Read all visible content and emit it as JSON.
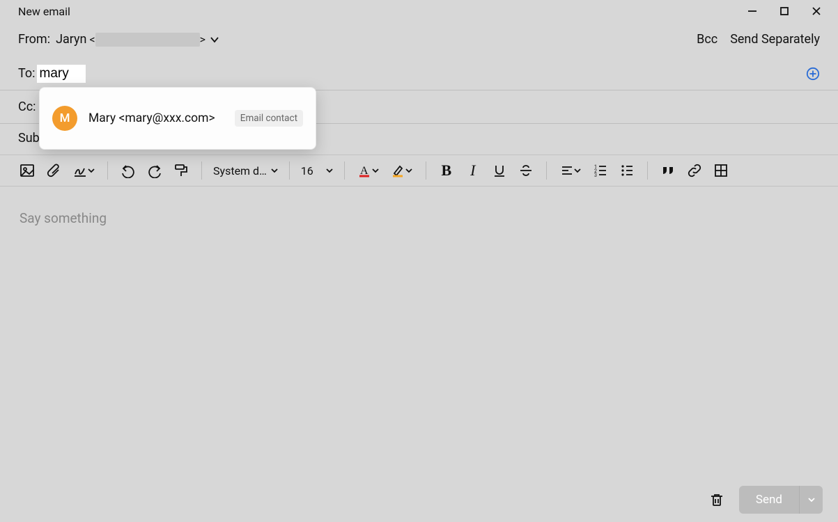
{
  "window": {
    "title": "New email"
  },
  "from": {
    "label": "From:",
    "name": "Jaryn",
    "prefix": "<",
    "suffix": ">"
  },
  "header_actions": {
    "bcc": "Bcc",
    "send_separately": "Send Separately"
  },
  "to": {
    "label": "To:",
    "value": "mary"
  },
  "cc": {
    "label": "Cc:"
  },
  "subject": {
    "label": "Subject:"
  },
  "autocomplete": {
    "avatar_initial": "M",
    "display": "Mary <mary@xxx.com>",
    "badge": "Email contact"
  },
  "toolbar": {
    "font_family": "System d…",
    "font_size": "16",
    "bold": "B",
    "italic": "I"
  },
  "body": {
    "placeholder": "Say something"
  },
  "footer": {
    "send": "Send"
  }
}
